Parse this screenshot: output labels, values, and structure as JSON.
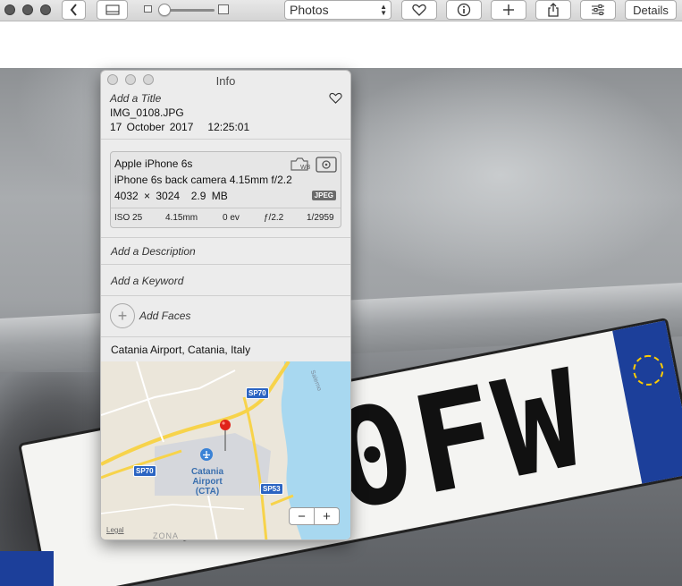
{
  "toolbar": {
    "view_select": "Photos",
    "details_label": "Details",
    "icons": [
      "back-icon",
      "sidebar-icon",
      "zoom-small-icon",
      "zoom-large-icon",
      "heart-icon",
      "info-icon",
      "add-icon",
      "share-icon",
      "adjust-icon"
    ],
    "zoom_level": 0.05
  },
  "info_panel": {
    "title": "Info",
    "add_title_placeholder": "Add a Title",
    "filename": "IMG_0108.JPG",
    "date": "17 October 2017",
    "time": "12:25:01",
    "camera": {
      "model": "Apple iPhone 6s",
      "lens": "iPhone 6s back camera 4.15mm f/2.2",
      "dimensions": "4032 × 3024",
      "filesize": "2.9 MB",
      "format_badge": "JPEG",
      "exif": {
        "iso": "ISO 25",
        "focal_length": "4.15mm",
        "exposure_bias": "0 ev",
        "aperture": "ƒ/2.2",
        "shutter": "1/2959"
      }
    },
    "add_description_placeholder": "Add a Description",
    "add_keyword_placeholder": "Add a Keyword",
    "add_faces_label": "Add Faces",
    "location": "Catania Airport, Catania, Italy",
    "map": {
      "airport_label_line1": "Catania",
      "airport_label_line2": "Airport",
      "airport_label_line3": "(CTA)",
      "road_labels": [
        "SP70",
        "SP70",
        "SP53"
      ],
      "street_label": "Salerno",
      "zona_label": "ZONA",
      "legal_label": "Legal",
      "zoom_out": "−",
      "zoom_in": "+"
    }
  },
  "photo": {
    "plate_text": "Z30FW"
  },
  "colors": {
    "panel_bg": "#ececec",
    "map_water": "#a8d8f0",
    "map_road": "#f7d34a",
    "pin": "#e0231a"
  }
}
